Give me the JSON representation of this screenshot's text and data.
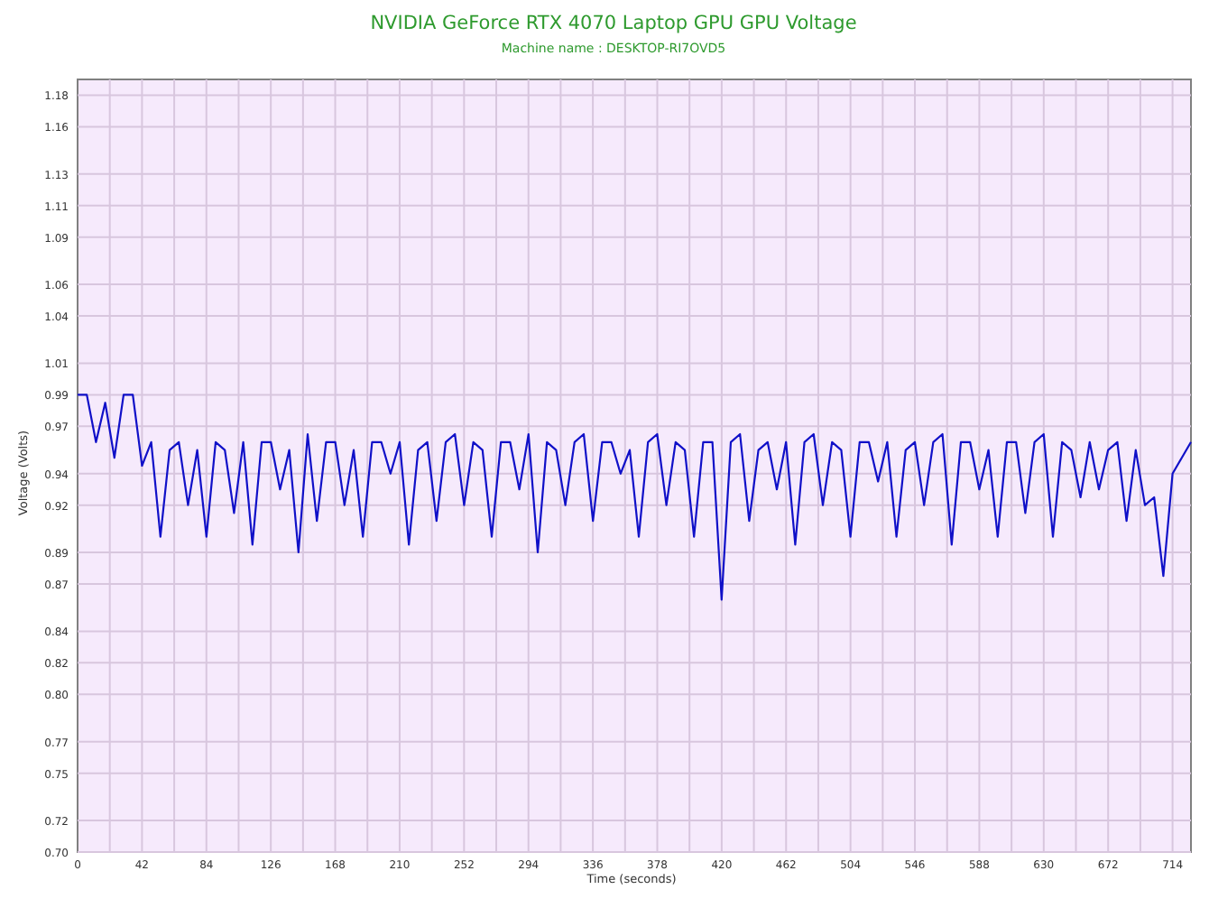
{
  "chart": {
    "machine_name": "Machine name : DESKTOP-RI7OVD5",
    "chart_data": {
      "type": "line",
      "title": "NVIDIA GeForce RTX 4070 Laptop GPU GPU Voltage",
      "xlabel": "Time (seconds)",
      "ylabel": "Voltage (Volts)",
      "xlim": [
        0,
        726
      ],
      "ylim": [
        0.7,
        1.19
      ],
      "xticks": [
        0,
        42,
        84,
        126,
        168,
        210,
        252,
        294,
        336,
        378,
        420,
        462,
        504,
        546,
        588,
        630,
        672,
        714
      ],
      "yticks": [
        {
          "value": 0.7,
          "label": "0.70"
        },
        {
          "value": 0.72,
          "label": "0.72"
        },
        {
          "value": 0.75,
          "label": "0.75"
        },
        {
          "value": 0.77,
          "label": "0.77"
        },
        {
          "value": 0.8,
          "label": "0.80"
        },
        {
          "value": 0.82,
          "label": "0.82"
        },
        {
          "value": 0.84,
          "label": "0.84"
        },
        {
          "value": 0.87,
          "label": "0.87"
        },
        {
          "value": 0.89,
          "label": "0.89"
        },
        {
          "value": 0.92,
          "label": "0.92"
        },
        {
          "value": 0.94,
          "label": "0.94"
        },
        {
          "value": 0.97,
          "label": "0.97"
        },
        {
          "value": 0.99,
          "label": "0.99"
        },
        {
          "value": 1.01,
          "label": "1.01"
        },
        {
          "value": 1.04,
          "label": "1.04"
        },
        {
          "value": 1.06,
          "label": "1.06"
        },
        {
          "value": 1.09,
          "label": "1.09"
        },
        {
          "value": 1.11,
          "label": "1.11"
        },
        {
          "value": 1.13,
          "label": "1.13"
        },
        {
          "value": 1.16,
          "label": "1.16"
        },
        {
          "value": 1.18,
          "label": "1.18"
        }
      ],
      "grid": true,
      "x": [
        0,
        6,
        12,
        18,
        24,
        30,
        36,
        42,
        48,
        54,
        60,
        66,
        72,
        78,
        84,
        90,
        96,
        102,
        108,
        114,
        120,
        126,
        132,
        138,
        144,
        150,
        156,
        162,
        168,
        174,
        180,
        186,
        192,
        198,
        204,
        210,
        216,
        222,
        228,
        234,
        240,
        246,
        252,
        258,
        264,
        270,
        276,
        282,
        288,
        294,
        300,
        306,
        312,
        318,
        324,
        330,
        336,
        342,
        348,
        354,
        360,
        366,
        372,
        378,
        384,
        390,
        396,
        402,
        408,
        414,
        420,
        426,
        432,
        438,
        444,
        450,
        456,
        462,
        468,
        474,
        480,
        486,
        492,
        498,
        504,
        510,
        516,
        522,
        528,
        534,
        540,
        546,
        552,
        558,
        564,
        570,
        576,
        582,
        588,
        594,
        600,
        606,
        612,
        618,
        624,
        630,
        636,
        642,
        648,
        654,
        660,
        666,
        672,
        678,
        684,
        690,
        696,
        702,
        708,
        714,
        720,
        726
      ],
      "series": [
        {
          "color": "#1010c8",
          "values": [
            0.99,
            0.99,
            0.96,
            0.985,
            0.95,
            0.99,
            0.99,
            0.945,
            0.96,
            0.9,
            0.955,
            0.96,
            0.92,
            0.955,
            0.9,
            0.96,
            0.955,
            0.915,
            0.96,
            0.895,
            0.96,
            0.96,
            0.93,
            0.955,
            0.89,
            0.965,
            0.91,
            0.96,
            0.96,
            0.92,
            0.955,
            0.9,
            0.96,
            0.96,
            0.94,
            0.96,
            0.895,
            0.955,
            0.96,
            0.91,
            0.96,
            0.965,
            0.92,
            0.96,
            0.955,
            0.9,
            0.96,
            0.96,
            0.93,
            0.965,
            0.89,
            0.96,
            0.955,
            0.92,
            0.96,
            0.965,
            0.91,
            0.96,
            0.96,
            0.94,
            0.955,
            0.9,
            0.96,
            0.965,
            0.92,
            0.96,
            0.955,
            0.9,
            0.96,
            0.96,
            0.86,
            0.96,
            0.965,
            0.91,
            0.955,
            0.96,
            0.93,
            0.96,
            0.895,
            0.96,
            0.965,
            0.92,
            0.96,
            0.955,
            0.9,
            0.96,
            0.96,
            0.935,
            0.96,
            0.9,
            0.955,
            0.96,
            0.92,
            0.96,
            0.965,
            0.895,
            0.96,
            0.96,
            0.93,
            0.955,
            0.9,
            0.96,
            0.96,
            0.915,
            0.96,
            0.965,
            0.9,
            0.96,
            0.955,
            0.925,
            0.96,
            0.93,
            0.955,
            0.96,
            0.91,
            0.955,
            0.92,
            0.925,
            0.875,
            0.94,
            0.95,
            0.96
          ]
        }
      ]
    }
  }
}
